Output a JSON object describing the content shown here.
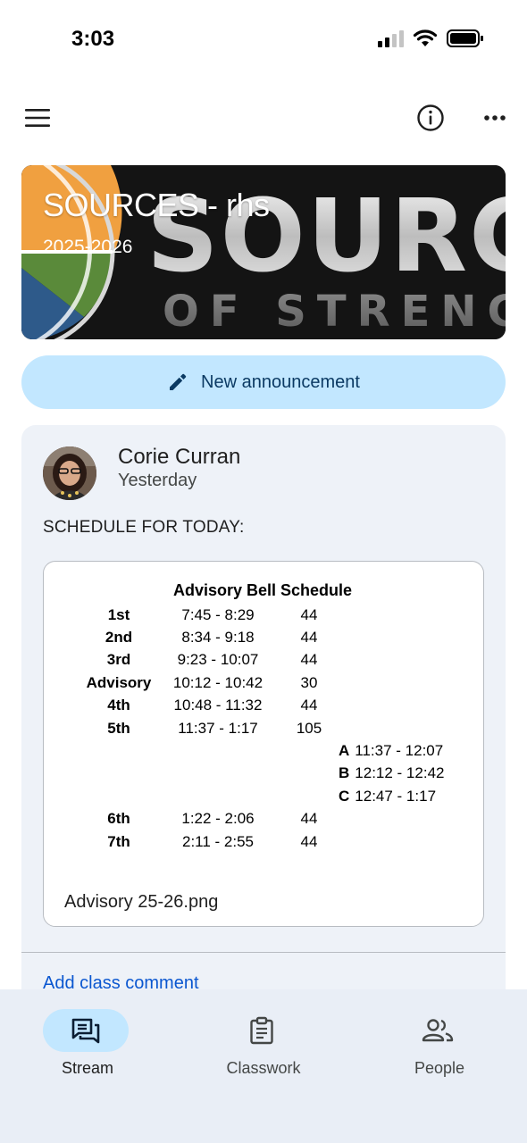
{
  "status_bar": {
    "time": "3:03"
  },
  "course": {
    "title": "SOURCES - rhs",
    "subtitle": "2025-2026",
    "banner_text_main": "SOURC",
    "banner_text_sub": "OF STRENG"
  },
  "actions": {
    "new_announcement": "New announcement"
  },
  "post": {
    "author": "Corie Curran",
    "time": "Yesterday",
    "text": "SCHEDULE FOR TODAY:",
    "attachment": {
      "filename": "Advisory 25-26.png",
      "schedule": {
        "title": "Advisory Bell Schedule",
        "rows": [
          {
            "period": "1st",
            "time": "7:45 - 8:29",
            "minutes": "44"
          },
          {
            "period": "2nd",
            "time": "8:34 - 9:18",
            "minutes": "44"
          },
          {
            "period": "3rd",
            "time": "9:23 - 10:07",
            "minutes": "44"
          },
          {
            "period": "Advisory",
            "time": "10:12 - 10:42",
            "minutes": "30"
          },
          {
            "period": "4th",
            "time": "10:48 - 11:32",
            "minutes": "44"
          },
          {
            "period": "5th",
            "time": "11:37 - 1:17",
            "minutes": "105"
          },
          {
            "period": "6th",
            "time": "1:22 - 2:06",
            "minutes": "44"
          },
          {
            "period": "7th",
            "time": "2:11 - 2:55",
            "minutes": "44"
          }
        ],
        "lunches": [
          {
            "letter": "A",
            "time": "11:37 - 12:07"
          },
          {
            "letter": "B",
            "time": "12:12 - 12:42"
          },
          {
            "letter": "C",
            "time": "12:47 - 1:17"
          }
        ]
      }
    },
    "comment_link": "Add class comment"
  },
  "bottom_nav": {
    "items": [
      {
        "label": "Stream",
        "icon": "stream-icon",
        "active": true
      },
      {
        "label": "Classwork",
        "icon": "classwork-icon",
        "active": false
      },
      {
        "label": "People",
        "icon": "people-icon",
        "active": false
      }
    ]
  },
  "colors": {
    "accent_light": "#c2e7ff",
    "accent_text": "#0b3a63",
    "link": "#0b57d0",
    "card_bg": "#eef2f8",
    "nav_bg": "#e9eef6"
  }
}
